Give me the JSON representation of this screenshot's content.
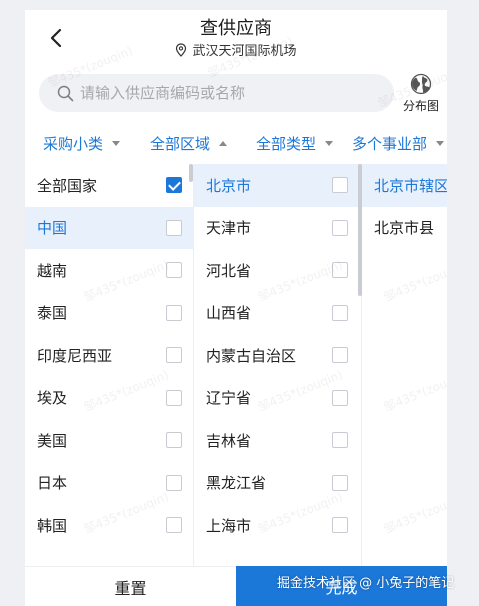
{
  "header": {
    "title": "查供应商",
    "location": "武汉天河国际机场"
  },
  "search": {
    "placeholder": "请输入供应商编码或名称"
  },
  "distribution": {
    "label": "分布图"
  },
  "filters": [
    {
      "label": "采购小类",
      "caret": "down"
    },
    {
      "label": "全部区域",
      "caret": "up"
    },
    {
      "label": "全部类型",
      "caret": "down"
    },
    {
      "label": "多个事业部",
      "caret": "down"
    }
  ],
  "countries": [
    {
      "label": "全部国家",
      "checked": true,
      "active": false
    },
    {
      "label": "中国",
      "checked": false,
      "active": true
    },
    {
      "label": "越南",
      "checked": false,
      "active": false
    },
    {
      "label": "泰国",
      "checked": false,
      "active": false
    },
    {
      "label": "印度尼西亚",
      "checked": false,
      "active": false
    },
    {
      "label": "埃及",
      "checked": false,
      "active": false
    },
    {
      "label": "美国",
      "checked": false,
      "active": false
    },
    {
      "label": "日本",
      "checked": false,
      "active": false
    },
    {
      "label": "韩国",
      "checked": false,
      "active": false
    }
  ],
  "provinces": [
    {
      "label": "北京市",
      "active": true
    },
    {
      "label": "天津市",
      "active": false
    },
    {
      "label": "河北省",
      "active": false
    },
    {
      "label": "山西省",
      "active": false
    },
    {
      "label": "内蒙古自治区",
      "active": false
    },
    {
      "label": "辽宁省",
      "active": false
    },
    {
      "label": "吉林省",
      "active": false
    },
    {
      "label": "黑龙江省",
      "active": false
    },
    {
      "label": "上海市",
      "active": false
    }
  ],
  "districts": [
    {
      "label": "北京市辖区",
      "active": true
    },
    {
      "label": "北京市县",
      "active": false
    }
  ],
  "footer": {
    "reset": "重置",
    "done": "完成"
  },
  "credit": "掘金技术社区 @ 小兔子的笔记",
  "watermark": "邹435*(zouqin)",
  "colors": {
    "accent": "#1b77d8",
    "active_bg": "#e8f0fc"
  }
}
